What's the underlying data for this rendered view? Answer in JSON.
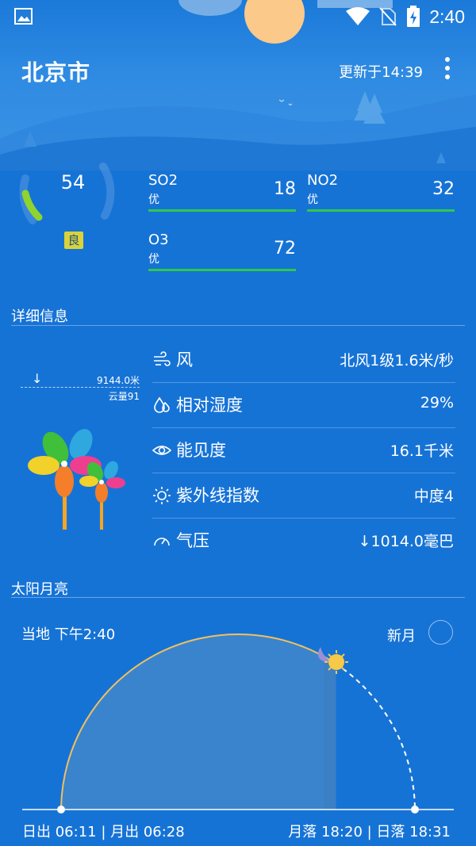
{
  "status_bar": {
    "time": "2:40",
    "icons": [
      "gallery-icon",
      "wifi-icon",
      "no-sim-icon",
      "battery-icon"
    ]
  },
  "header": {
    "city": "北京市",
    "update_text": "更新于14:39"
  },
  "aqi": {
    "value": "54",
    "level": "良",
    "pollutants": [
      {
        "name": "SO2",
        "grade": "优",
        "value": "18"
      },
      {
        "name": "NO2",
        "grade": "优",
        "value": "32"
      },
      {
        "name": "O3",
        "grade": "优",
        "value": "72"
      }
    ],
    "good_color": "#2ec94a",
    "level_color": "#d9d23a"
  },
  "details": {
    "title": "详细信息",
    "cloud_height": "9144.0米",
    "cloud_amount": "云量91",
    "rows": [
      {
        "icon": "wind-icon",
        "label": "风",
        "value": "北风1级1.6米/秒"
      },
      {
        "icon": "humidity-icon",
        "label": "相对湿度",
        "value": "29%"
      },
      {
        "icon": "eye-icon",
        "label": "能见度",
        "value": "16.1千米"
      },
      {
        "icon": "sun-uv-icon",
        "label": "紫外线指数",
        "value": "中度4"
      },
      {
        "icon": "pressure-gauge-icon",
        "label": "气压",
        "value": "↓1014.0毫巴"
      }
    ]
  },
  "sun_moon": {
    "title": "太阳月亮",
    "local_time": "当地 下午2:40",
    "moon_phase": "新月",
    "sunrise_moonrise": "日出 06:11 | 月出 06:28",
    "moonset_sunset": "月落 18:20 | 日落 18:31",
    "arc_color": "#f0c060"
  }
}
